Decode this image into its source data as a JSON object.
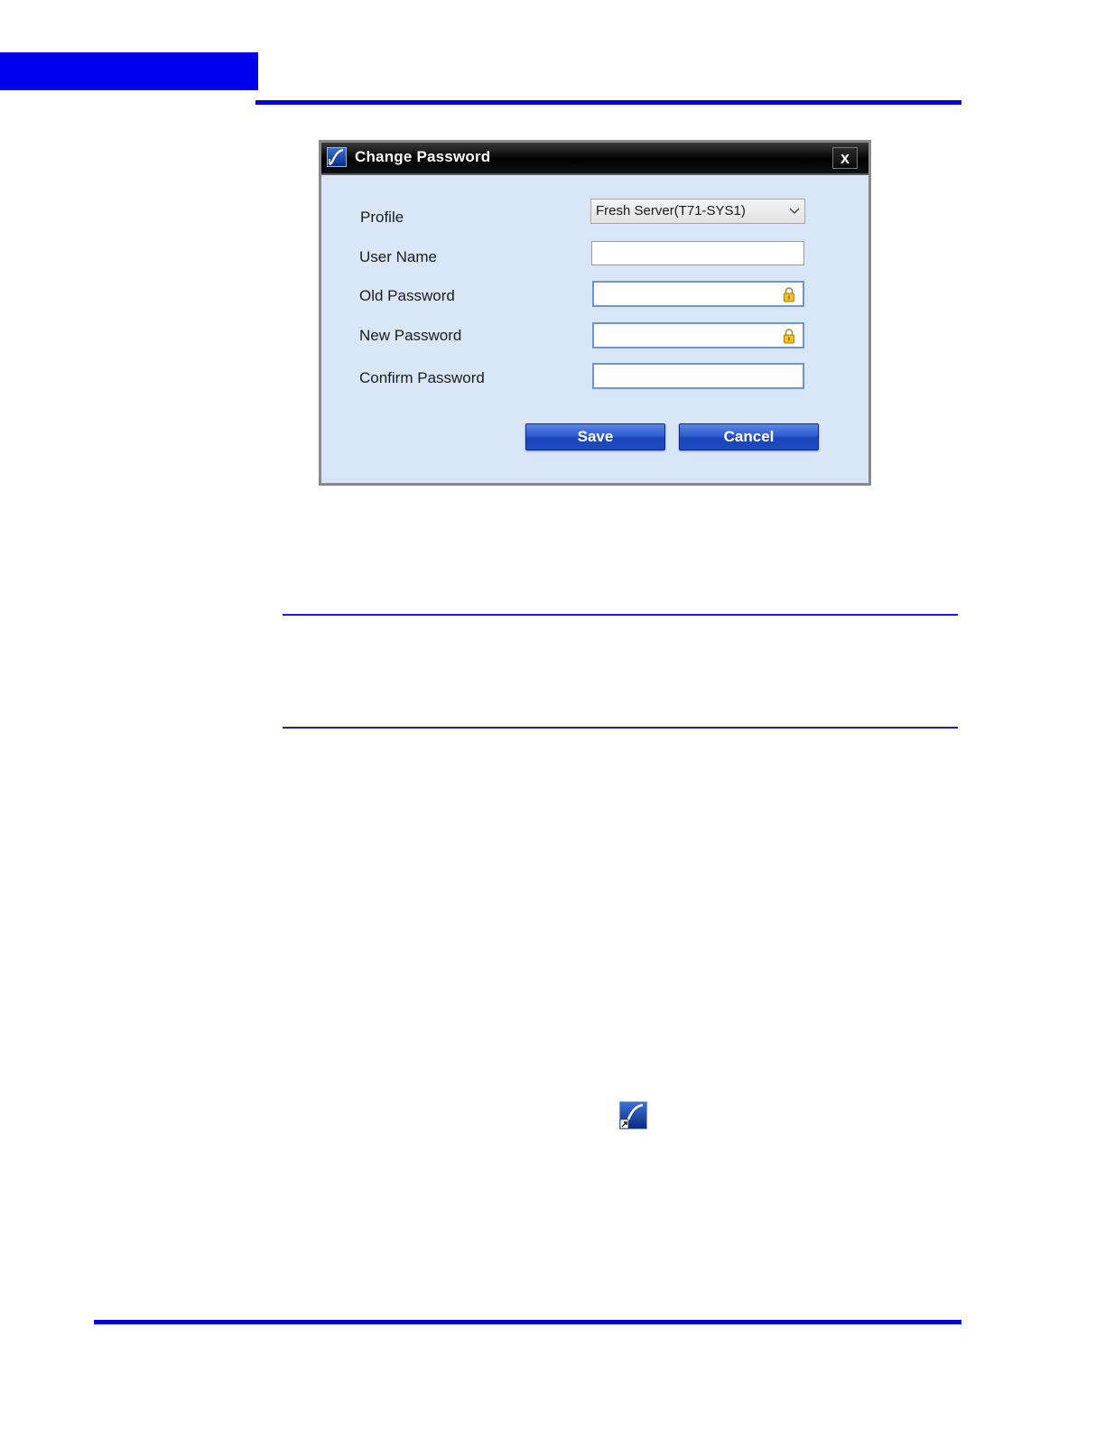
{
  "page": {
    "accent_color": "#0000ee"
  },
  "dialog": {
    "title": "Change Password",
    "close_label": "x",
    "app_icon": "app-logo-icon",
    "fields": {
      "profile_label": "Profile",
      "profile_value": "Fresh Server(T71-SYS1)",
      "user_name_label": "User Name",
      "user_name_value": "",
      "old_password_label": "Old Password",
      "old_password_value": "",
      "new_password_label": "New Password",
      "new_password_value": "",
      "confirm_password_label": "Confirm Password",
      "confirm_password_value": ""
    },
    "buttons": {
      "save_label": "Save",
      "cancel_label": "Cancel"
    },
    "colors": {
      "dialog_background": "#d9e6f8",
      "button_blue": "#2f5dd0",
      "titlebar": "#000000"
    }
  },
  "desktop_icon": {
    "icon": "app-shortcut-icon"
  }
}
